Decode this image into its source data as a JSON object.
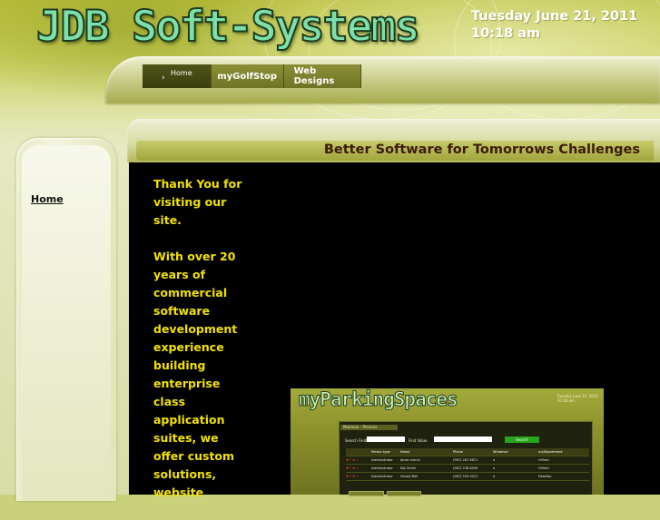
{
  "header": {
    "logo_text": "JDB Soft-Systems",
    "date": "Tuesday June 21, 2011",
    "time": "10:18 am"
  },
  "nav": {
    "items": [
      {
        "label": "Home"
      },
      {
        "label": "myGolfStop"
      },
      {
        "label": "Web Designs"
      }
    ]
  },
  "sidebar": {
    "links": [
      {
        "label": "Home"
      }
    ]
  },
  "content": {
    "title": "Better Software for Tomorrows Challenges",
    "paragraphs": [
      "Thank You for visiting our site.",
      "With over 20 years of commercial software development experience building enterprise class application suites, we offer custom solutions, website"
    ]
  },
  "screenshot": {
    "logo_text": "myParkingSpaces",
    "date_line1": "Tuesday June 21, 2011",
    "date_line2": "10:18 am",
    "panel_title": "Maintain – Persons",
    "search_field_label": "Search Field",
    "find_value_label": "Find Value",
    "search_button": "Search",
    "table": {
      "headers": [
        "",
        "Person type",
        "Name",
        "Phone",
        "Whatever",
        "myDepartment"
      ],
      "rows": [
        [
          "✖ ? ⚙ ⚠",
          "Administrator",
          "Jacob morris",
          "(987) 287-6671",
          "a",
          "Ufribel"
        ],
        [
          "✖ ? ⚙ ⚠",
          "Administrator",
          "Kat Smith",
          "(987) 238-6549",
          "a",
          "Ufribel"
        ],
        [
          "✖ ? ⚙ ⚠",
          "Administrator",
          "Harold Bell",
          "(987) 555-5221",
          "a",
          "Desktop"
        ]
      ]
    }
  },
  "colors": {
    "background": "#c9d17a",
    "content_bg": "#000000",
    "intro_text": "#f2e100",
    "title_text": "#3d1a08",
    "logo": "#7ce0a8"
  }
}
